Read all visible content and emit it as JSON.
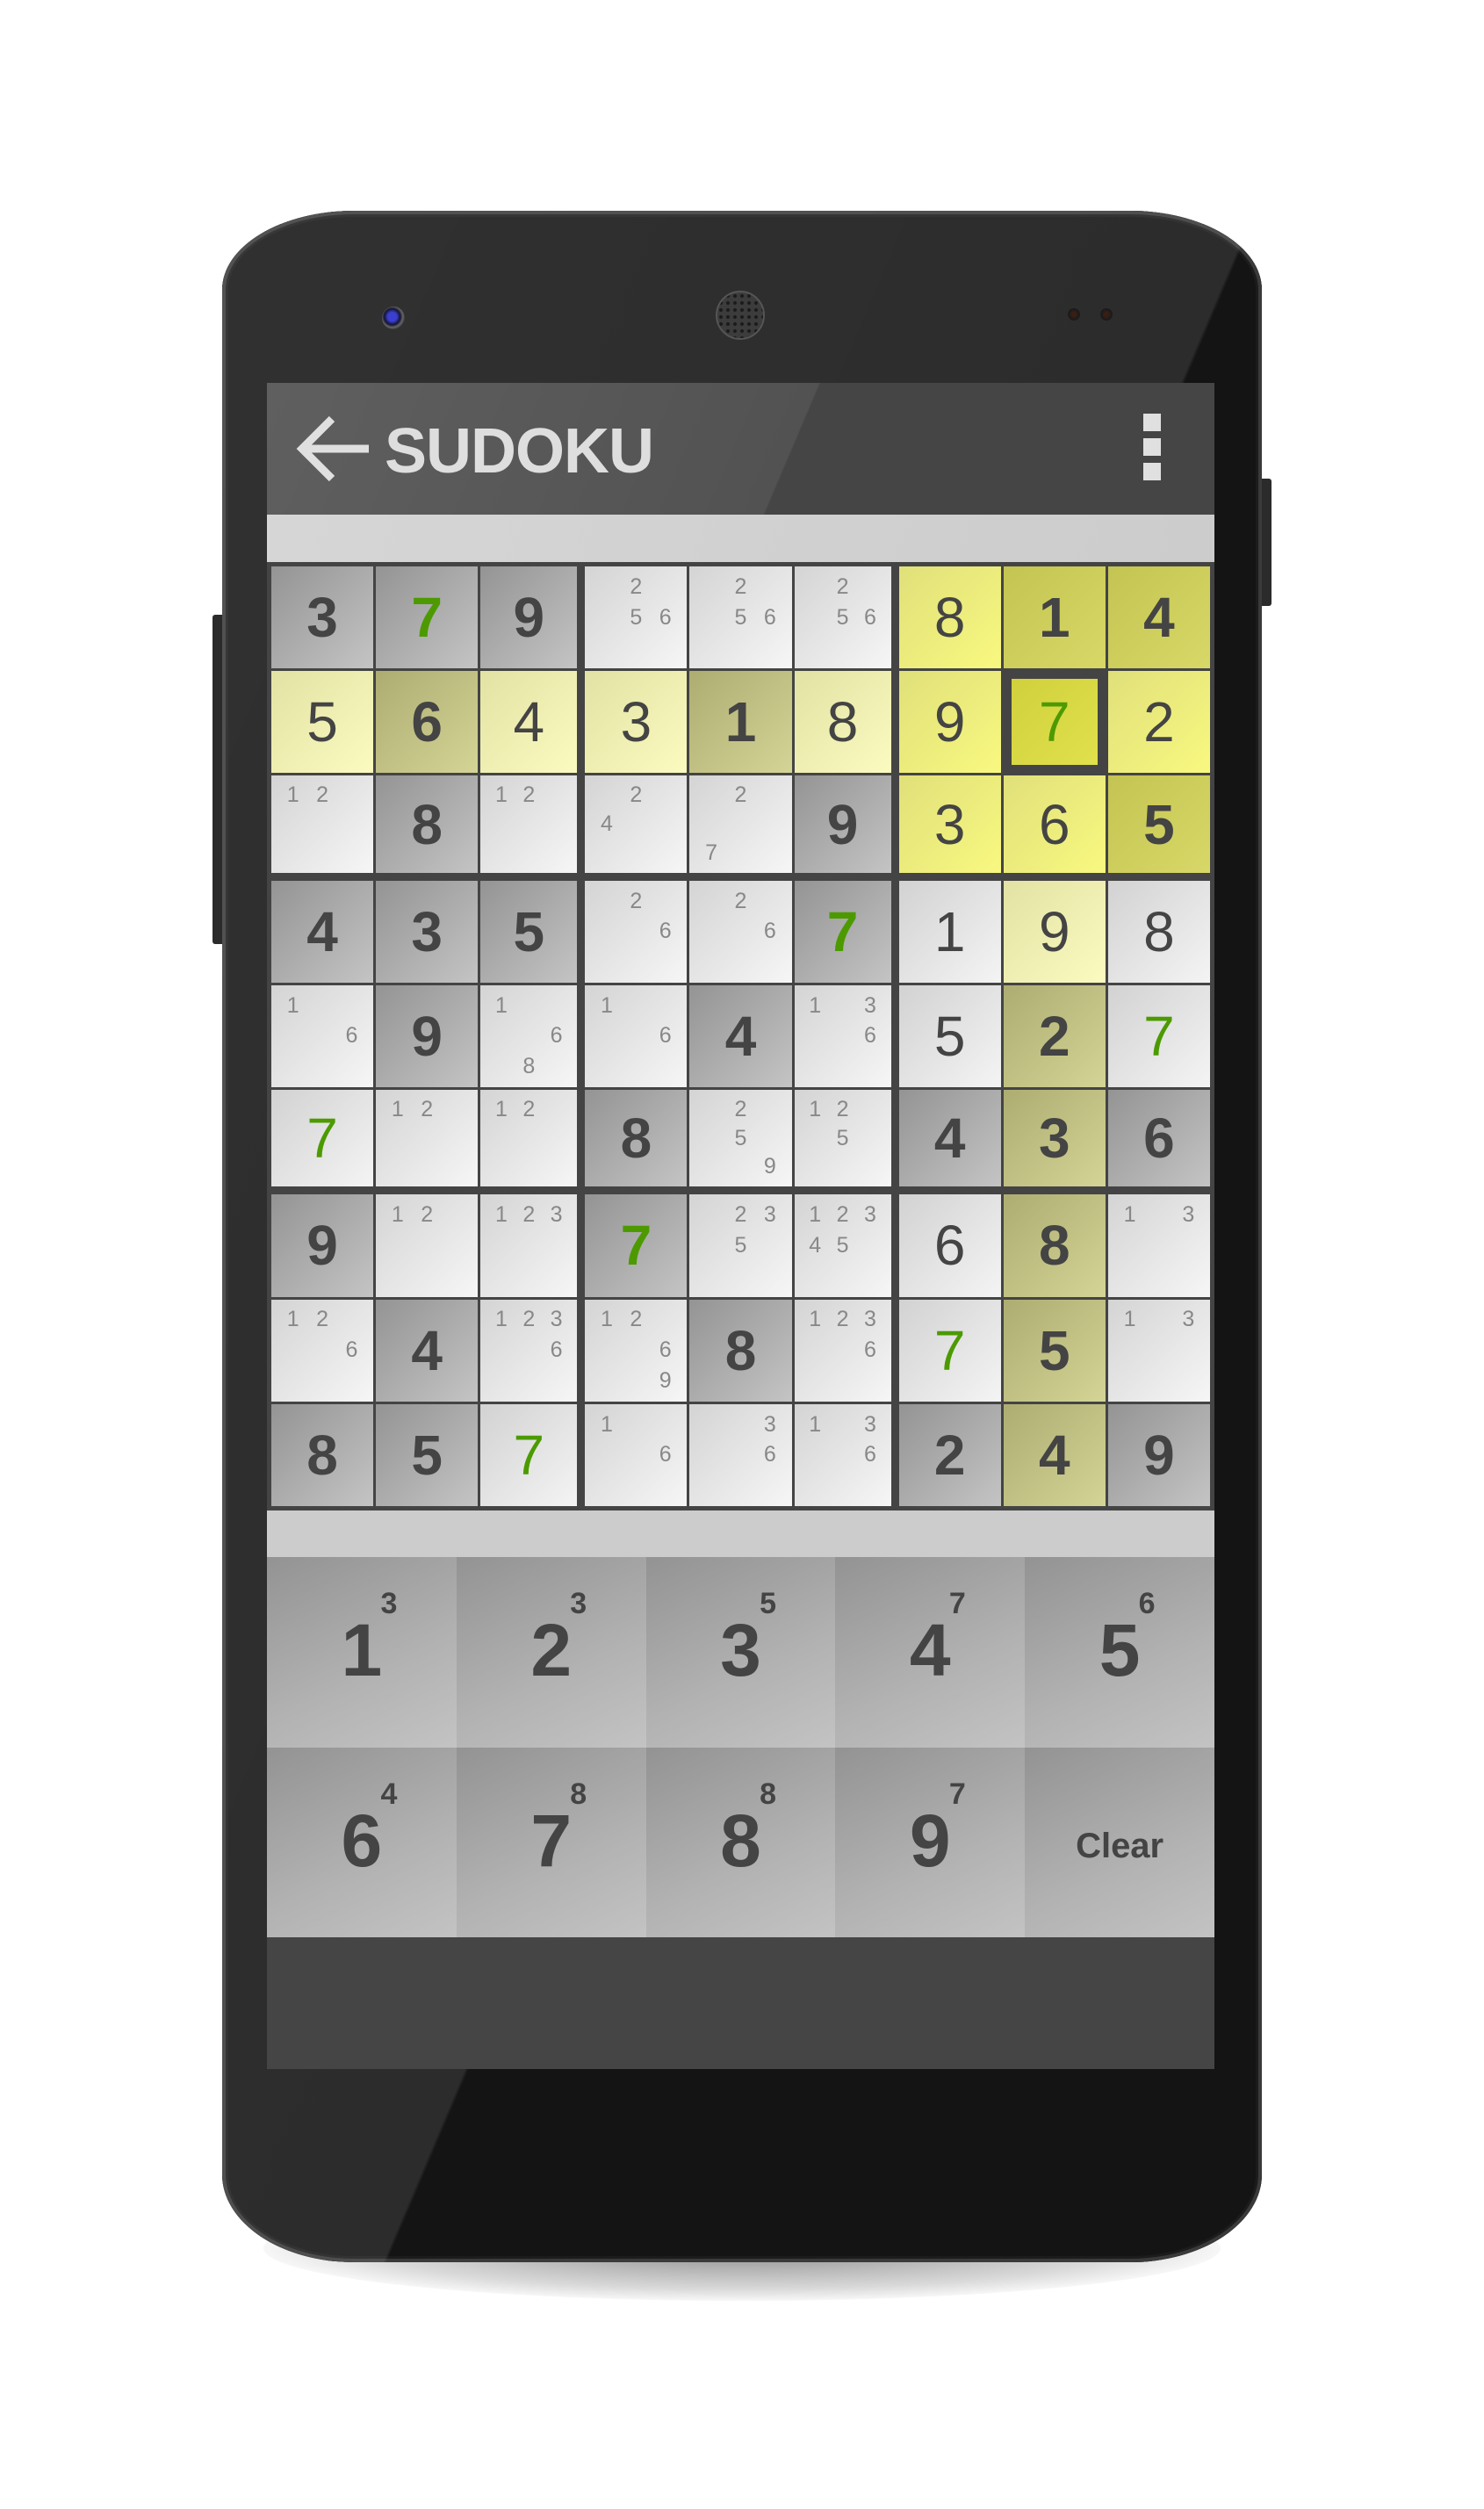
{
  "app": {
    "title": "SUDOKU",
    "back_icon": "arrow-left-icon",
    "menu_icon": "overflow-menu-icon"
  },
  "colors": {
    "highlight_value": "#4c9a00",
    "selected_cell": "#d6d644",
    "highlight_row_col_box": "#f4f4b4",
    "given_cell": "#acacac",
    "empty_cell": "#e6e6e6",
    "grid_lines": "#444444"
  },
  "selected": {
    "row": 1,
    "col": 7,
    "value": 7
  },
  "grid": [
    [
      {
        "v": 3,
        "given": true
      },
      {
        "v": 7,
        "given": true
      },
      {
        "v": 9,
        "given": true
      },
      {
        "notes": [
          2,
          5,
          6
        ]
      },
      {
        "notes": [
          2,
          5,
          6
        ]
      },
      {
        "notes": [
          2,
          5,
          6
        ]
      },
      {
        "v": 8
      },
      {
        "v": 1,
        "given": true
      },
      {
        "v": 4,
        "given": true
      }
    ],
    [
      {
        "v": 5
      },
      {
        "v": 6,
        "given": true
      },
      {
        "v": 4
      },
      {
        "v": 3
      },
      {
        "v": 1,
        "given": true
      },
      {
        "v": 8
      },
      {
        "v": 9
      },
      {
        "v": 7
      },
      {
        "v": 2
      }
    ],
    [
      {
        "notes": [
          1,
          2
        ]
      },
      {
        "v": 8,
        "given": true
      },
      {
        "notes": [
          1,
          2
        ]
      },
      {
        "notes": [
          2,
          4
        ]
      },
      {
        "notes": [
          2,
          7
        ]
      },
      {
        "v": 9,
        "given": true
      },
      {
        "v": 3
      },
      {
        "v": 6
      },
      {
        "v": 5,
        "given": true
      }
    ],
    [
      {
        "v": 4,
        "given": true
      },
      {
        "v": 3,
        "given": true
      },
      {
        "v": 5,
        "given": true
      },
      {
        "notes": [
          2,
          6
        ]
      },
      {
        "notes": [
          2,
          6
        ]
      },
      {
        "v": 7,
        "given": true
      },
      {
        "v": 1
      },
      {
        "v": 9
      },
      {
        "v": 8
      }
    ],
    [
      {
        "notes": [
          1,
          6
        ]
      },
      {
        "v": 9,
        "given": true
      },
      {
        "notes": [
          1,
          6,
          8
        ]
      },
      {
        "notes": [
          1,
          6
        ]
      },
      {
        "v": 4,
        "given": true
      },
      {
        "notes": [
          1,
          3,
          6
        ]
      },
      {
        "v": 5
      },
      {
        "v": 2,
        "given": true
      },
      {
        "v": 7
      }
    ],
    [
      {
        "v": 7
      },
      {
        "notes": [
          1,
          2
        ]
      },
      {
        "notes": [
          1,
          2
        ]
      },
      {
        "v": 8,
        "given": true
      },
      {
        "notes": [
          2,
          5,
          9
        ]
      },
      {
        "notes": [
          1,
          2,
          5
        ]
      },
      {
        "v": 4,
        "given": true
      },
      {
        "v": 3,
        "given": true
      },
      {
        "v": 6,
        "given": true
      }
    ],
    [
      {
        "v": 9,
        "given": true
      },
      {
        "notes": [
          1,
          2
        ]
      },
      {
        "notes": [
          1,
          2,
          3
        ]
      },
      {
        "v": 7,
        "given": true
      },
      {
        "notes": [
          2,
          3,
          5
        ]
      },
      {
        "notes": [
          1,
          2,
          3,
          4,
          5
        ]
      },
      {
        "v": 6
      },
      {
        "v": 8,
        "given": true
      },
      {
        "notes": [
          1,
          3
        ]
      }
    ],
    [
      {
        "notes": [
          1,
          2,
          6
        ]
      },
      {
        "v": 4,
        "given": true
      },
      {
        "notes": [
          1,
          2,
          3,
          6
        ]
      },
      {
        "notes": [
          1,
          2,
          6,
          9
        ]
      },
      {
        "v": 8,
        "given": true
      },
      {
        "notes": [
          1,
          2,
          3,
          6
        ]
      },
      {
        "v": 7
      },
      {
        "v": 5,
        "given": true
      },
      {
        "notes": [
          1,
          3
        ]
      }
    ],
    [
      {
        "v": 8,
        "given": true
      },
      {
        "v": 5,
        "given": true
      },
      {
        "v": 7
      },
      {
        "notes": [
          1,
          6
        ]
      },
      {
        "notes": [
          3,
          6
        ]
      },
      {
        "notes": [
          1,
          3,
          6
        ]
      },
      {
        "v": 2,
        "given": true
      },
      {
        "v": 4,
        "given": true
      },
      {
        "v": 9,
        "given": true
      }
    ]
  ],
  "keypad": {
    "keys": [
      {
        "digit": "1",
        "remaining": "3"
      },
      {
        "digit": "2",
        "remaining": "3"
      },
      {
        "digit": "3",
        "remaining": "5"
      },
      {
        "digit": "4",
        "remaining": "7"
      },
      {
        "digit": "5",
        "remaining": "6"
      },
      {
        "digit": "6",
        "remaining": "4"
      },
      {
        "digit": "7",
        "remaining": "8"
      },
      {
        "digit": "8",
        "remaining": "8"
      },
      {
        "digit": "9",
        "remaining": "7"
      }
    ],
    "clear_label": "Clear"
  }
}
